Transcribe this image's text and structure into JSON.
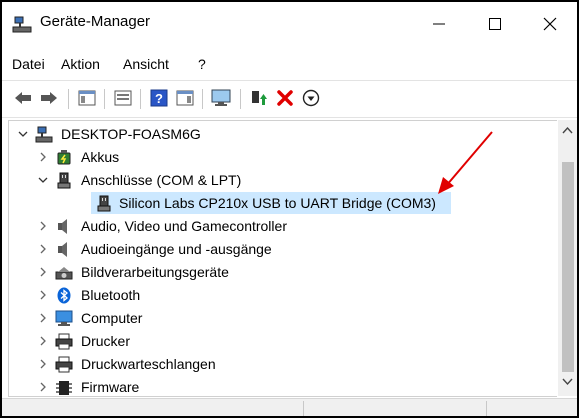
{
  "window": {
    "title": "Geräte-Manager",
    "buttons": {
      "minimize": "—",
      "maximize": "☐",
      "close": "✕"
    }
  },
  "menu": [
    "Datei",
    "Aktion",
    "Ansicht",
    "?"
  ],
  "toolbar": {
    "icons": [
      "back-icon",
      "forward-icon",
      "show-hide-console-icon",
      "properties-icon",
      "help-icon",
      "action-pane-icon",
      "monitor-icon",
      "update-driver-icon",
      "uninstall-icon",
      "disable-device-icon"
    ]
  },
  "tree": {
    "root": "DESKTOP-FOASM6G",
    "items": [
      {
        "label": "Akkus",
        "icon": "battery-icon"
      },
      {
        "label": "Anschlüsse (COM & LPT)",
        "icon": "port-icon",
        "expanded": true,
        "children": [
          {
            "label": "Silicon Labs CP210x USB to UART Bridge (COM3)",
            "icon": "port-icon",
            "selected": true
          }
        ]
      },
      {
        "label": "Audio, Video und Gamecontroller",
        "icon": "speaker-icon"
      },
      {
        "label": "Audioeingänge und -ausgänge",
        "icon": "speaker-icon"
      },
      {
        "label": "Bildverarbeitungsgeräte",
        "icon": "camera-icon"
      },
      {
        "label": "Bluetooth",
        "icon": "bluetooth-icon"
      },
      {
        "label": "Computer",
        "icon": "computer-icon"
      },
      {
        "label": "Drucker",
        "icon": "printer-icon"
      },
      {
        "label": "Druckwarteschlangen",
        "icon": "printer-icon"
      },
      {
        "label": "Firmware",
        "icon": "firmware-icon"
      }
    ]
  },
  "annotation": {
    "arrow_color": "#e00000"
  },
  "colors": {
    "selection": "#cce8ff",
    "delete_red": "#e00000"
  }
}
